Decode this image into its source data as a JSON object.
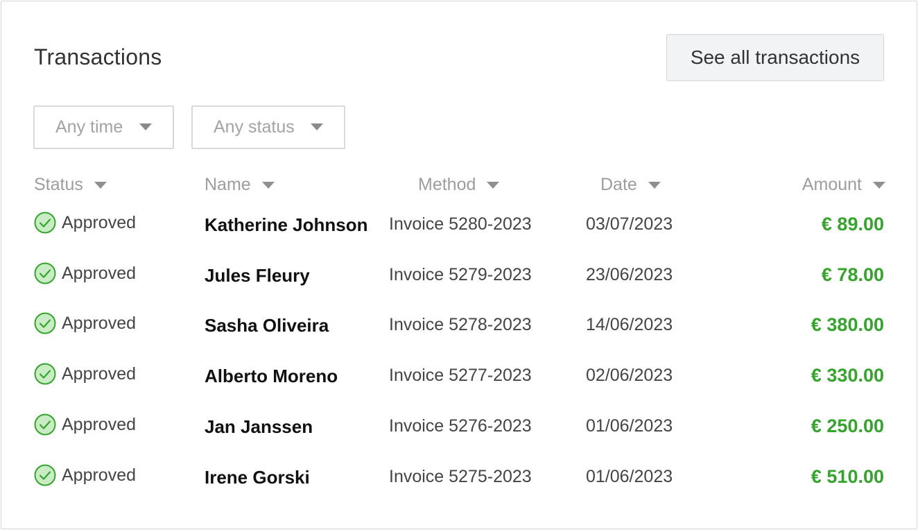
{
  "header": {
    "title": "Transactions",
    "see_all_label": "See all transactions"
  },
  "filters": {
    "time": "Any time",
    "status": "Any status"
  },
  "columns": {
    "status": "Status",
    "name": "Name",
    "method": "Method",
    "date": "Date",
    "amount": "Amount"
  },
  "rows": [
    {
      "status": "Approved",
      "name": "Katherine Johnson",
      "method": "Invoice 5280-2023",
      "date": "03/07/2023",
      "amount": "€ 89.00"
    },
    {
      "status": "Approved",
      "name": "Jules Fleury",
      "method": "Invoice 5279-2023",
      "date": "23/06/2023",
      "amount": "€ 78.00"
    },
    {
      "status": "Approved",
      "name": "Sasha Oliveira",
      "method": "Invoice 5278-2023",
      "date": "14/06/2023",
      "amount": "€ 380.00"
    },
    {
      "status": "Approved",
      "name": "Alberto Moreno",
      "method": "Invoice 5277-2023",
      "date": "02/06/2023",
      "amount": "€ 330.00"
    },
    {
      "status": "Approved",
      "name": "Jan Janssen",
      "method": "Invoice 5276-2023",
      "date": "01/06/2023",
      "amount": "€ 250.00"
    },
    {
      "status": "Approved",
      "name": "Irene Gorski",
      "method": "Invoice 5275-2023",
      "date": "01/06/2023",
      "amount": "€ 510.00"
    }
  ],
  "colors": {
    "approved_green": "#33a52b",
    "approved_icon_fill": "#c9ecc4"
  },
  "icons": {
    "status": "check-circle-icon",
    "sort": "caret-down-icon"
  }
}
